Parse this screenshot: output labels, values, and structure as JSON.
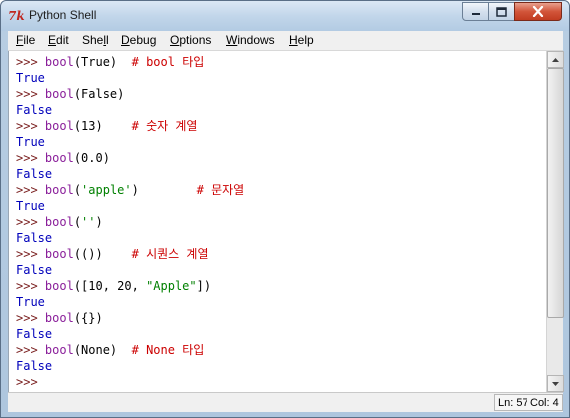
{
  "window": {
    "title": "Python Shell",
    "app_icon_glyph": "7k"
  },
  "menu": [
    {
      "label_u": "F",
      "label_rest": "ile"
    },
    {
      "label_u": "E",
      "label_rest": "dit"
    },
    {
      "label_pre": "She",
      "label_u": "l",
      "label_rest": "l"
    },
    {
      "label_u": "D",
      "label_rest": "ebug"
    },
    {
      "label_u": "O",
      "label_rest": "ptions"
    },
    {
      "label_u": "W",
      "label_rest": "indows"
    },
    {
      "label_u": "H",
      "label_rest": "elp"
    }
  ],
  "shell": {
    "prompt": ">>> ",
    "lines": [
      {
        "type": "input",
        "func": "bool",
        "arg_pre": "(True)",
        "pad": "  ",
        "comment": "# bool 타입"
      },
      {
        "type": "output",
        "text": "True"
      },
      {
        "type": "input",
        "func": "bool",
        "arg_pre": "(False)",
        "pad": "",
        "comment": ""
      },
      {
        "type": "output",
        "text": "False"
      },
      {
        "type": "input",
        "func": "bool",
        "arg_pre": "(13)",
        "pad": "    ",
        "comment": "# 숫자 계열"
      },
      {
        "type": "output",
        "text": "True"
      },
      {
        "type": "input",
        "func": "bool",
        "arg_pre": "(0.0)",
        "pad": "",
        "comment": ""
      },
      {
        "type": "output",
        "text": "False"
      },
      {
        "type": "input_str",
        "func": "bool",
        "open": "(",
        "str": "'apple'",
        "close": ")",
        "pad": "        ",
        "comment": "# 문자열"
      },
      {
        "type": "output",
        "text": "True"
      },
      {
        "type": "input_str",
        "func": "bool",
        "open": "(",
        "str": "''",
        "close": ")",
        "pad": "",
        "comment": ""
      },
      {
        "type": "output",
        "text": "False"
      },
      {
        "type": "input",
        "func": "bool",
        "arg_pre": "(())",
        "pad": "    ",
        "comment": "# 시퀀스 계열"
      },
      {
        "type": "output",
        "text": "False"
      },
      {
        "type": "input_str",
        "func": "bool",
        "open": "([10, 20, ",
        "str": "\"Apple\"",
        "close": "])",
        "pad": "",
        "comment": ""
      },
      {
        "type": "output",
        "text": "True"
      },
      {
        "type": "input",
        "func": "bool",
        "arg_pre": "({})",
        "pad": "",
        "comment": ""
      },
      {
        "type": "output",
        "text": "False"
      },
      {
        "type": "input",
        "func": "bool",
        "arg_pre": "(None)",
        "pad": "  ",
        "comment": "# None 타입"
      },
      {
        "type": "output",
        "text": "False"
      },
      {
        "type": "prompt_only"
      }
    ]
  },
  "status": {
    "line": "Ln: 57",
    "col": "Col: 4"
  },
  "colors": {
    "prompt": "#7a1f1f",
    "builtin": "#8a1f9a",
    "string": "#008000",
    "comment": "#cc0000",
    "output": "#0000bb"
  }
}
